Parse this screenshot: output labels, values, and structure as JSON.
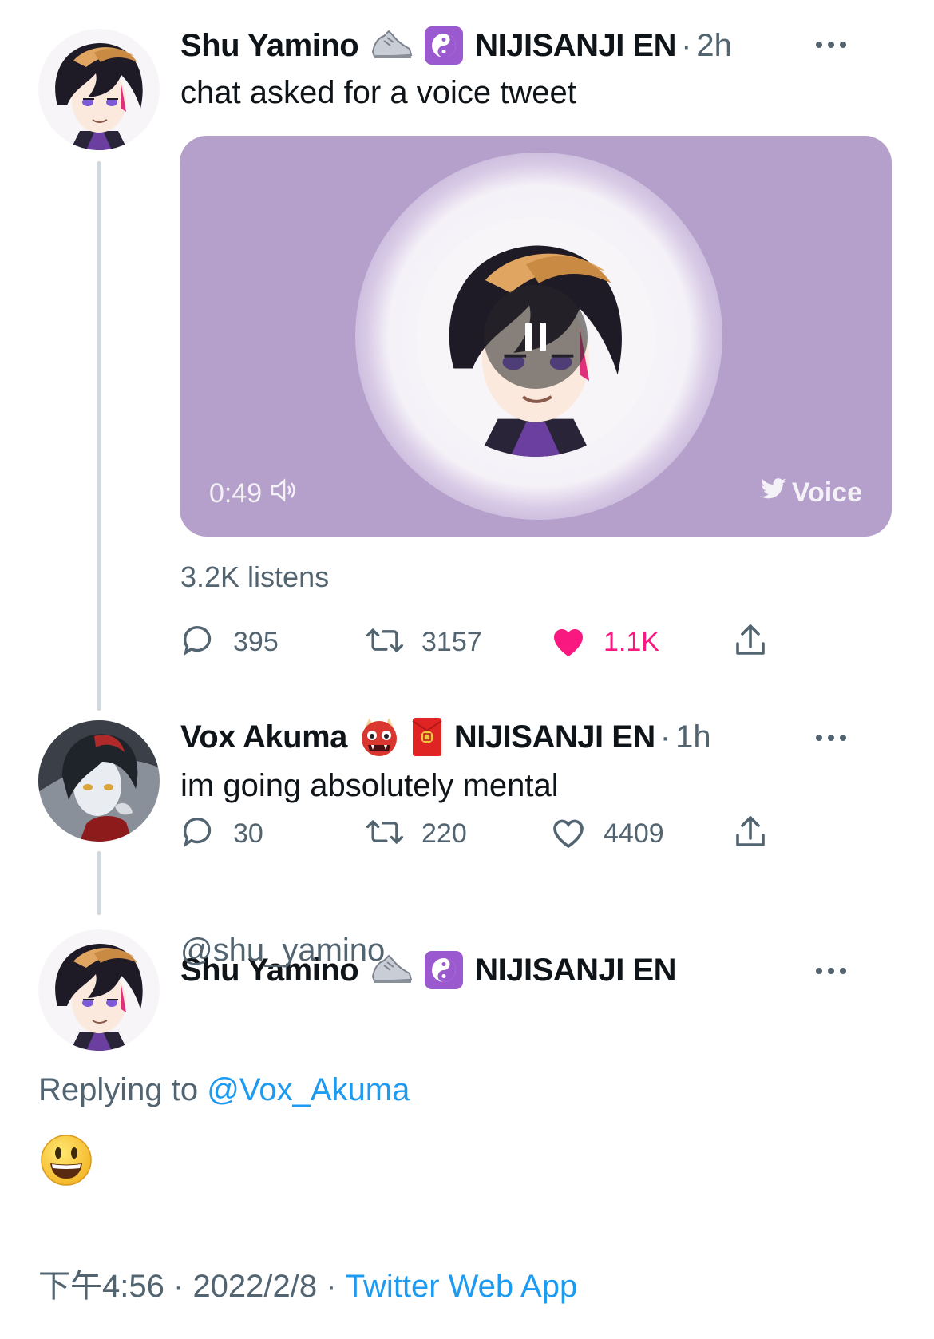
{
  "tweets": [
    {
      "name": "Shu Yamino",
      "emojis": [
        "sneaker-emoji",
        "yin-yang-emoji"
      ],
      "affiliation": "NIJISANJI EN",
      "separator": "·",
      "time": "2h",
      "text": "chat asked for a voice tweet",
      "voice": {
        "duration": "0:49",
        "label": "Voice"
      },
      "listens": "3.2K listens",
      "replies": "395",
      "retweets": "3157",
      "likes": "1.1K",
      "liked": true
    },
    {
      "name": "Vox Akuma",
      "emojis": [
        "ogre-emoji",
        "red-envelope-emoji"
      ],
      "affiliation": "NIJISANJI EN",
      "separator": "·",
      "time": "1h",
      "text": "im going absolutely mental",
      "replies": "30",
      "retweets": "220",
      "likes": "4409",
      "liked": false
    }
  ],
  "focused": {
    "name": "Shu Yamino",
    "emojis": [
      "sneaker-emoji",
      "yin-yang-emoji"
    ],
    "affiliation": "NIJISANJI EN",
    "handle": "@shu_yamino",
    "replying_prefix": "Replying to",
    "replying_to": "@Vox_Akuma",
    "content": "😃",
    "time": "下午4:56",
    "date": "2022/2/8",
    "separator": "·",
    "source": "Twitter Web App"
  },
  "colors": {
    "voice_card": "#b59fcb",
    "like_pink": "#f91880",
    "link_blue": "#1d9bf0",
    "muted": "#536471"
  }
}
